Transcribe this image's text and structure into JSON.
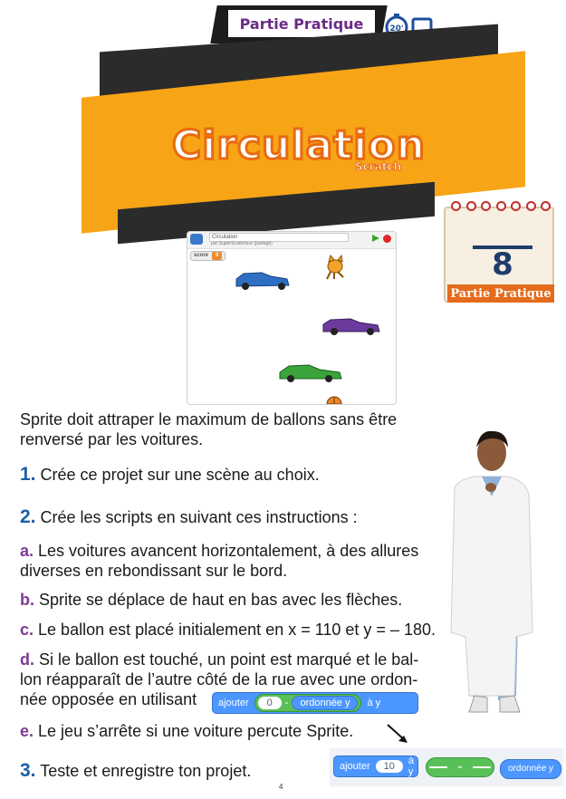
{
  "header": {
    "badge_label": "Partie Pratique",
    "timer_label": "20'"
  },
  "banner": {
    "title": "Circulation",
    "subtitle": "Scratch"
  },
  "calendar": {
    "number": "8",
    "label": "Partie Pratique"
  },
  "stage": {
    "project_title": "Circulation",
    "author": "par SuperScratcheur (partagé)",
    "score_label": "score",
    "score_value": "0"
  },
  "intro": "Sprite doit attraper le maximum de ballons sans être renversé par les voitures.",
  "steps": {
    "s1_num": "1.",
    "s1_text": "Crée ce projet sur une scène au choix.",
    "s2_num": "2.",
    "s2_text": "Crée les scripts en suivant ces instructions :",
    "a_letter": "a.",
    "a_text": "Les voitures avancent horizontalement, à des allures diverses en rebondissant sur le bord.",
    "b_letter": "b.",
    "b_text": "Sprite se déplace de haut en bas avec les flèches.",
    "c_letter": "c.",
    "c_text": "Le ballon est placé initialement en x = 110 et y = – 180.",
    "d_letter": "d.",
    "d_text_1": "Si le ballon est touché, un point est marqué et le bal-",
    "d_text_2": "lon réapparaît de l’autre côté de la rue avec une ordon-",
    "d_text_3": "née opposée en utilisant",
    "e_letter": "e.",
    "e_text": "Le jeu s’arrête si une voiture percute Sprite.",
    "s3_num": "3.",
    "s3_text": "Teste et enregistre ton projet."
  },
  "blocks": {
    "main": {
      "add_label": "ajouter",
      "zero": "0",
      "minus": "-",
      "reporter": "ordonnée y",
      "to_label": "à y"
    },
    "parts": {
      "add_label": "ajouter",
      "ten": "10",
      "to_label": "à y",
      "minus": "-",
      "reporter": "ordonnée y"
    }
  },
  "page_number": "4",
  "colors": {
    "orange": "#f8a417",
    "dark": "#2b2b2b",
    "blue_num": "#1a5fa8",
    "purple_letter": "#7d3a94",
    "scratch_motion": "#4c97ff",
    "scratch_operator": "#59c059"
  }
}
